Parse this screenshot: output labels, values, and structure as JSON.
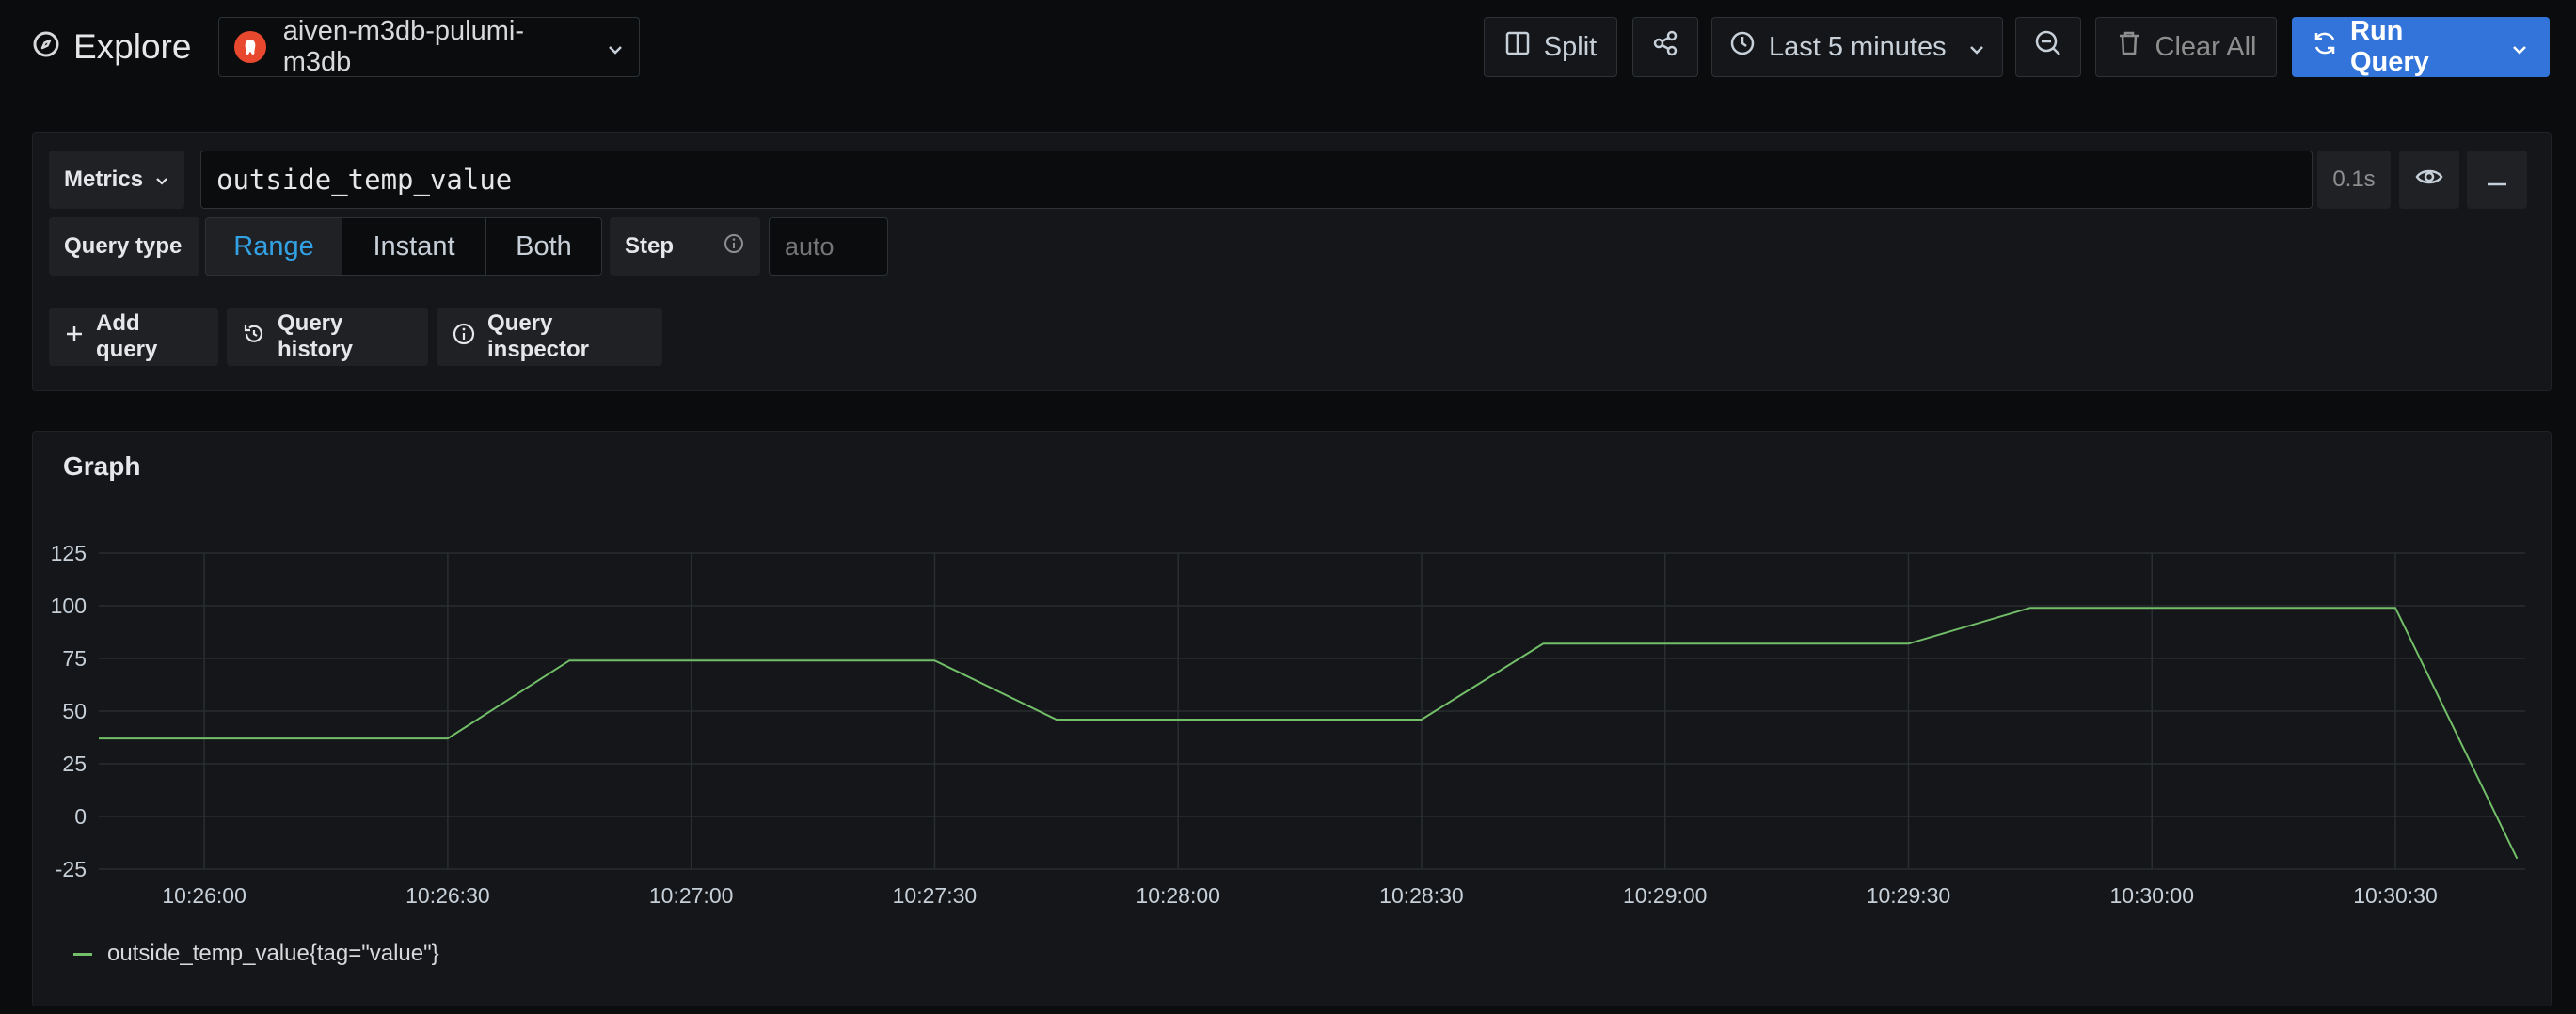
{
  "header": {
    "title": "Explore",
    "datasource": "aiven-m3db-pulumi-m3db",
    "split_label": "Split",
    "time_range": "Last 5 minutes",
    "clear_label": "Clear All",
    "run_label": "Run Query"
  },
  "query": {
    "metrics_label": "Metrics",
    "expression": "outside_temp_value",
    "duration": "0.1s",
    "query_type_label": "Query type",
    "query_types": [
      "Range",
      "Instant",
      "Both"
    ],
    "active_query_type": "Range",
    "step_label": "Step",
    "step_placeholder": "auto"
  },
  "actions": {
    "add_query": "Add query",
    "query_history": "Query history",
    "query_inspector": "Query inspector"
  },
  "graph": {
    "title": "Graph",
    "legend": "outside_temp_value{tag=\"value\"}"
  },
  "colors": {
    "accent": "#3274d9",
    "series": "#73bf69",
    "active_tab": "#33a2e5"
  },
  "chart_data": {
    "type": "line",
    "title": "Graph",
    "xlabel": "",
    "ylabel": "",
    "y_ticks": [
      125,
      100,
      75,
      50,
      25,
      0,
      -25
    ],
    "ylim": [
      -25,
      125
    ],
    "x_ticks": [
      "10:26:00",
      "10:26:30",
      "10:27:00",
      "10:27:30",
      "10:28:00",
      "10:28:30",
      "10:29:00",
      "10:29:30",
      "10:30:00",
      "10:30:30"
    ],
    "xlim": [
      "10:25:47",
      "10:30:46"
    ],
    "grid": true,
    "legend_position": "bottom-left",
    "series": [
      {
        "name": "outside_temp_value{tag=\"value\"}",
        "x": [
          "10:25:47",
          "10:26:30",
          "10:26:45",
          "10:27:30",
          "10:27:45",
          "10:28:30",
          "10:28:45",
          "10:29:30",
          "10:29:45",
          "10:30:30",
          "10:30:45"
        ],
        "y": [
          37,
          37,
          74,
          74,
          46,
          46,
          82,
          82,
          99,
          99,
          -20
        ]
      }
    ]
  }
}
